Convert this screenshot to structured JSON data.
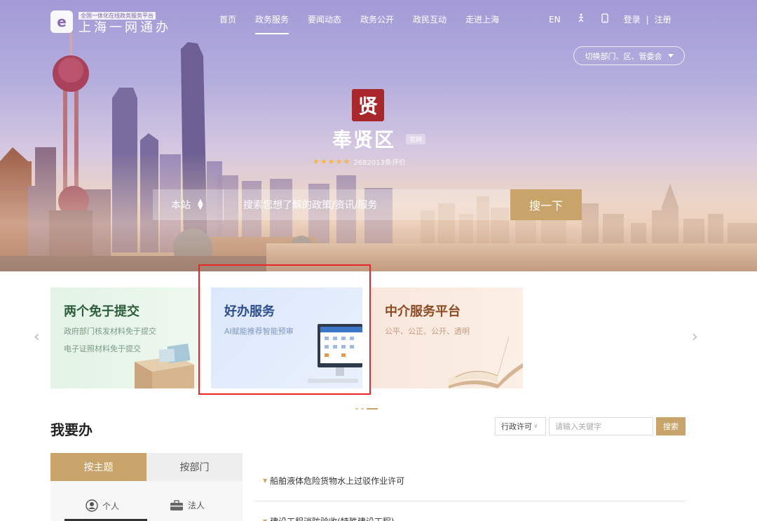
{
  "brand": {
    "tag": "全国一体化在线政务服务平台",
    "name": "上海一网通办",
    "logo_char": "e"
  },
  "nav": {
    "items": [
      "首页",
      "政务服务",
      "要闻动态",
      "政务公开",
      "政民互动",
      "走进上海"
    ],
    "active_index": 1,
    "right": {
      "lang": "EN",
      "accessibility_icon": "accessibility-icon",
      "mobile_icon": "mobile-icon",
      "login": "登录",
      "sep": "|",
      "register": "注册"
    }
  },
  "switcher": {
    "label": "切换部门、区、管委会"
  },
  "district": {
    "seal_char": "贤",
    "name": "奉贤区",
    "badge": "官网",
    "stars": 5,
    "reviews": "2682013条评价"
  },
  "search": {
    "scope": "本站",
    "placeholder": "搜索您想了解的政策/资讯/服务",
    "button": "搜一下"
  },
  "carousel": {
    "prev": "‹",
    "next": "›",
    "cards": [
      {
        "title": "两个免于提交",
        "lines": [
          "政府部门核发材料免于提交",
          "电子证照材料免于提交"
        ]
      },
      {
        "title": "好办服务",
        "lines": [
          "AI赋能推荐智能预审"
        ]
      },
      {
        "title": "中介服务平台",
        "lines": [
          "公平、公正、公开、透明"
        ]
      }
    ],
    "highlighted_index": 1,
    "active_dot": 2
  },
  "services": {
    "title": "我要办",
    "filter": {
      "select": "行政许可",
      "placeholder": "请输入关键字",
      "button": "搜索"
    },
    "tabs": [
      "按主题",
      "按部门"
    ],
    "active_tab": 0,
    "subtabs": [
      "个人",
      "法人"
    ],
    "items": [
      "船舶液体危险货物水上过驳作业许可",
      "建设工程消防验收(特殊建设工程)"
    ]
  },
  "colors": {
    "accent": "#c9a46a",
    "highlight": "#e8252a",
    "seal": "#a8272b"
  }
}
